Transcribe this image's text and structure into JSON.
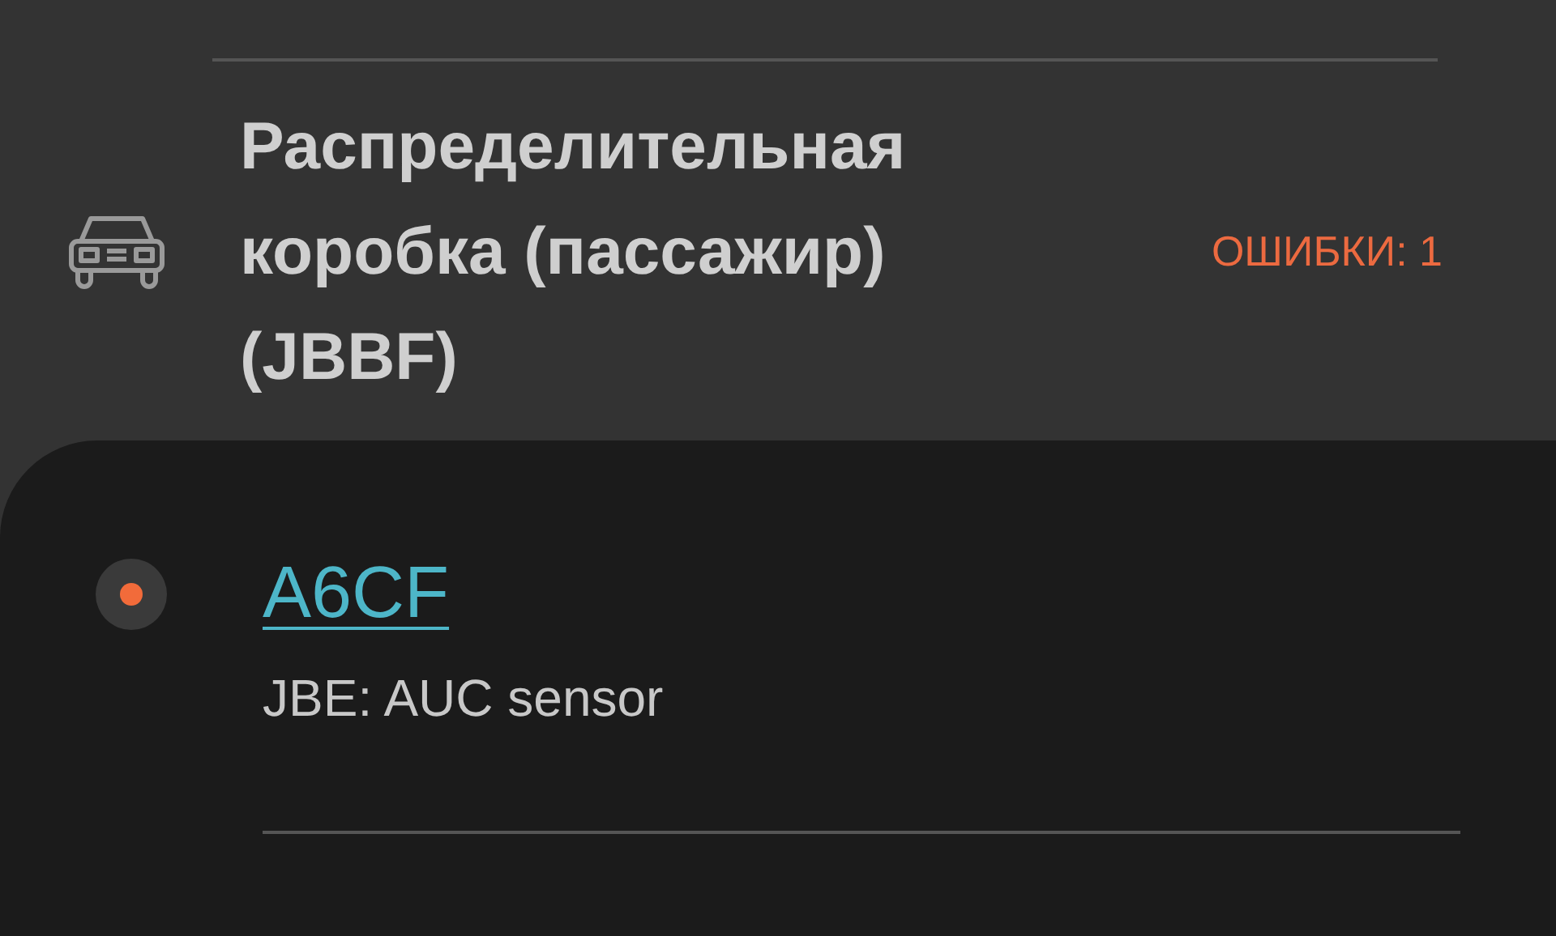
{
  "module": {
    "title": "Распределительная коробка (пассажир) (JBBF)",
    "errors": "ОШИБКИ: 1"
  },
  "faults": [
    {
      "code": "A6CF",
      "description": "JBE: AUC sensor",
      "color": "#f26b3a"
    }
  ]
}
